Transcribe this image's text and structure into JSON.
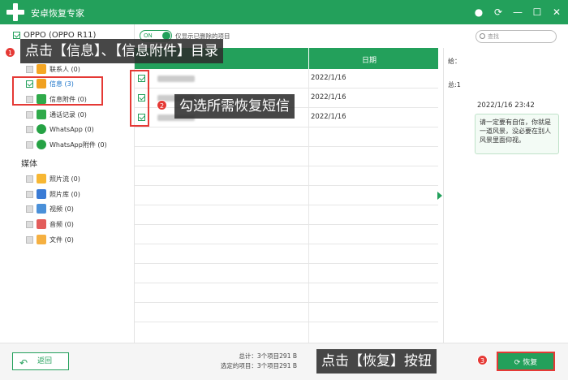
{
  "app": {
    "title": "安卓恢复专家"
  },
  "device": {
    "name": "OPPO (OPPO R11)"
  },
  "toggle": {
    "state": "ON",
    "label": "仅显示已删除的项目"
  },
  "search": {
    "placeholder": "查找"
  },
  "sidebar": {
    "items": [
      {
        "label": "联系人 (0)",
        "checked": false
      },
      {
        "label": "信息 (3)",
        "checked": true
      },
      {
        "label": "信息附件 (0)",
        "checked": false
      },
      {
        "label": "通话记录 (0)",
        "checked": false
      },
      {
        "label": "WhatsApp (0)",
        "checked": false
      },
      {
        "label": "WhatsApp附件 (0)",
        "checked": false
      }
    ],
    "media_label": "媒体",
    "media": [
      {
        "label": "照片流 (0)"
      },
      {
        "label": "照片库 (0)"
      },
      {
        "label": "视频 (0)"
      },
      {
        "label": "音频 (0)"
      },
      {
        "label": "文件 (0)"
      }
    ]
  },
  "table": {
    "header_date": "日期",
    "rows": [
      {
        "date": "2022/1/16"
      },
      {
        "date": "2022/1/16"
      },
      {
        "date": "2022/1/16"
      }
    ]
  },
  "detail": {
    "to": "给：",
    "total": "总:1",
    "time": "2022/1/16 23:42",
    "message": "请一定要有自信，你就是一道风景，没必要在别人风景里面仰视。"
  },
  "footer": {
    "back": "返回",
    "total": "总计：3个项目291 B",
    "selected": "选定的项目：3个项目291 B",
    "restore": "恢复"
  },
  "overlays": {
    "step1": "点击【信息】、【信息附件】目录",
    "step2": "勾选所需恢复短信",
    "step3": "点击【恢复】按钮",
    "badge1": "1",
    "badge2": "2",
    "badge3": "3"
  },
  "colors": {
    "accent": "#23a05b",
    "highlight": "#e53935"
  }
}
